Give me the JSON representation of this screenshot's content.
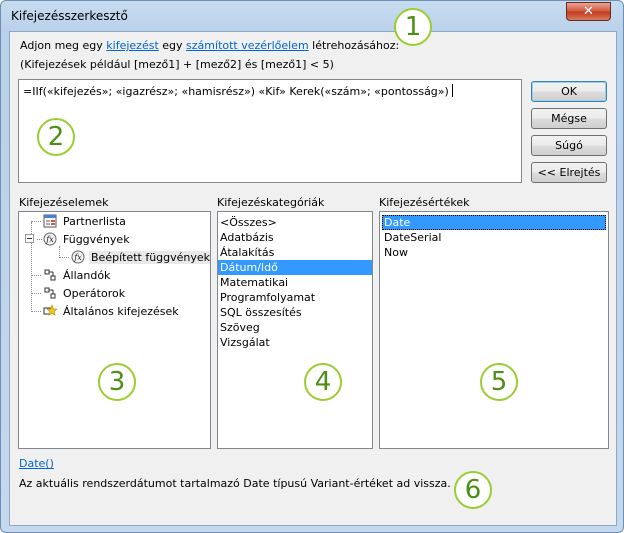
{
  "window": {
    "title": "Kifejezésszerkesztő",
    "close_glyph": "✕"
  },
  "intro": {
    "prefix": "Adjon meg egy ",
    "link1": "kifejezést",
    "middle": " egy ",
    "link2": "számított vezérlőelem",
    "suffix": " létrehozásához:",
    "example": "(Kifejezések például [mező1] + [mező2] és [mező1] < 5)"
  },
  "expression": {
    "value": "=IIf(«kifejezés»; «igazrész»; «hamisrész») «Kif» Kerek(«szám»; «pontosság»)"
  },
  "buttons": {
    "ok": "OK",
    "cancel": "Mégse",
    "help": "Súgó",
    "collapse": "<< Elrejtés"
  },
  "panes": {
    "elements": {
      "label": "Kifejezéselemek",
      "items": [
        "Partnerlista",
        "Függvények",
        "Beépített függvények",
        "Állandók",
        "Operátorok",
        "Általános kifejezések"
      ]
    },
    "categories": {
      "label": "Kifejezéskategóriák",
      "items": [
        "<Összes>",
        "Adatbázis",
        "Átalakítás",
        "Dátum/Idő",
        "Matematikai",
        "Programfolyamat",
        "SQL összesítés",
        "Szöveg",
        "Vizsgálat"
      ],
      "selected": "Dátum/Idő"
    },
    "values": {
      "label": "Kifejezésértékek",
      "items": [
        "Date",
        "DateSerial",
        "Now"
      ],
      "selected": "Date"
    }
  },
  "function_info": {
    "signature": "Date()",
    "description": "Az aktuális rendszerdátumot tartalmazó Date típusú Variant-értéket ad vissza."
  },
  "callouts": [
    "1",
    "2",
    "3",
    "4",
    "5",
    "6"
  ],
  "colors": {
    "accent": "#3399ff",
    "link": "#0066cc",
    "callout": "#9acd32"
  }
}
